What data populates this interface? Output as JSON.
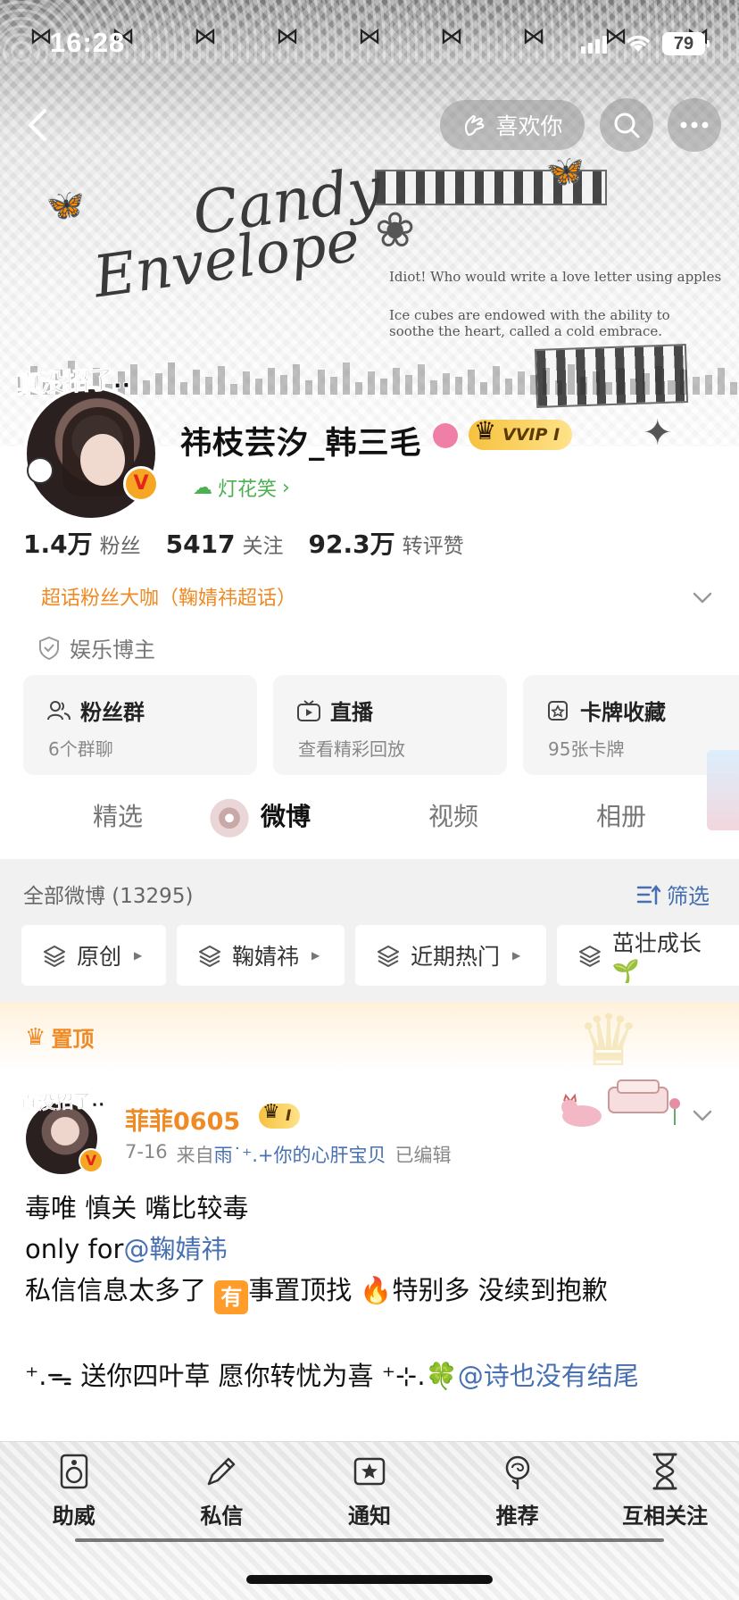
{
  "status_bar": {
    "time": "16:28",
    "battery": "79"
  },
  "header": {
    "like_label": "喜欢你",
    "banner": {
      "title_line1": "Candy",
      "title_line2": "Envelope",
      "quote1": "Idiot! Who would write a love letter using apples",
      "quote2": "Ice cubes are endowed with the ability to soothe the heart, called a cold embrace."
    }
  },
  "profile": {
    "avatar_sticker": "真没招了..",
    "username": "祎枝芸汐_韩三毛",
    "vip_label": "VVIP I",
    "group_link": "灯花笑",
    "stats": [
      {
        "num": "1.4万",
        "label": "粉丝"
      },
      {
        "num": "5417",
        "label": "关注"
      },
      {
        "num": "92.3万",
        "label": "转评赞"
      }
    ],
    "superfan": "超话粉丝大咖（鞠婧祎超话）",
    "certification": "娱乐博主"
  },
  "cards": [
    {
      "title": "粉丝群",
      "sub": "6个群聊",
      "icon": "people-icon"
    },
    {
      "title": "直播",
      "sub": "查看精彩回放",
      "icon": "tv-icon"
    },
    {
      "title": "卡牌收藏",
      "sub": "95张卡牌",
      "icon": "card-icon"
    }
  ],
  "tabs": [
    {
      "label": "精选"
    },
    {
      "label": "微博"
    },
    {
      "label": "视频"
    },
    {
      "label": "相册"
    }
  ],
  "feed": {
    "all_label": "全部微博 (13295)",
    "filter_label": "筛选",
    "chips": [
      {
        "label": "原创"
      },
      {
        "label": "鞠婧祎"
      },
      {
        "label": "近期热门"
      },
      {
        "label": "茁壮成长🌱"
      }
    ]
  },
  "pinned": {
    "label": "置顶",
    "post": {
      "sticker": "真没招了..",
      "author": "菲菲0605",
      "vip_label": "I",
      "date": "7-16",
      "from_prefix": "来自",
      "source": "雨˙⁺.+你的心肝宝贝",
      "edited": "已编辑",
      "line1": "毒唯 慎关 嘴比较毒",
      "line2_prefix": "only for",
      "line2_mention": "@鞠婧祎",
      "line3_a": "私信信息太多了 ",
      "line3_badge": "有",
      "line3_b": "事置顶找 🔥特别多 没续到抱歉",
      "line4_text": "⁺.ᯓ 送你四叶草 愿你转忧为喜 ⁺⊹.🍀",
      "line4_mention": "@诗也没有结尾"
    }
  },
  "bottom_bar": {
    "items": [
      {
        "label": "助威",
        "icon": "speaker-icon"
      },
      {
        "label": "私信",
        "icon": "pen-icon"
      },
      {
        "label": "通知",
        "icon": "star-card-icon"
      },
      {
        "label": "推荐",
        "icon": "rose-icon"
      },
      {
        "label": "互相关注",
        "icon": "hourglass-icon"
      }
    ]
  }
}
